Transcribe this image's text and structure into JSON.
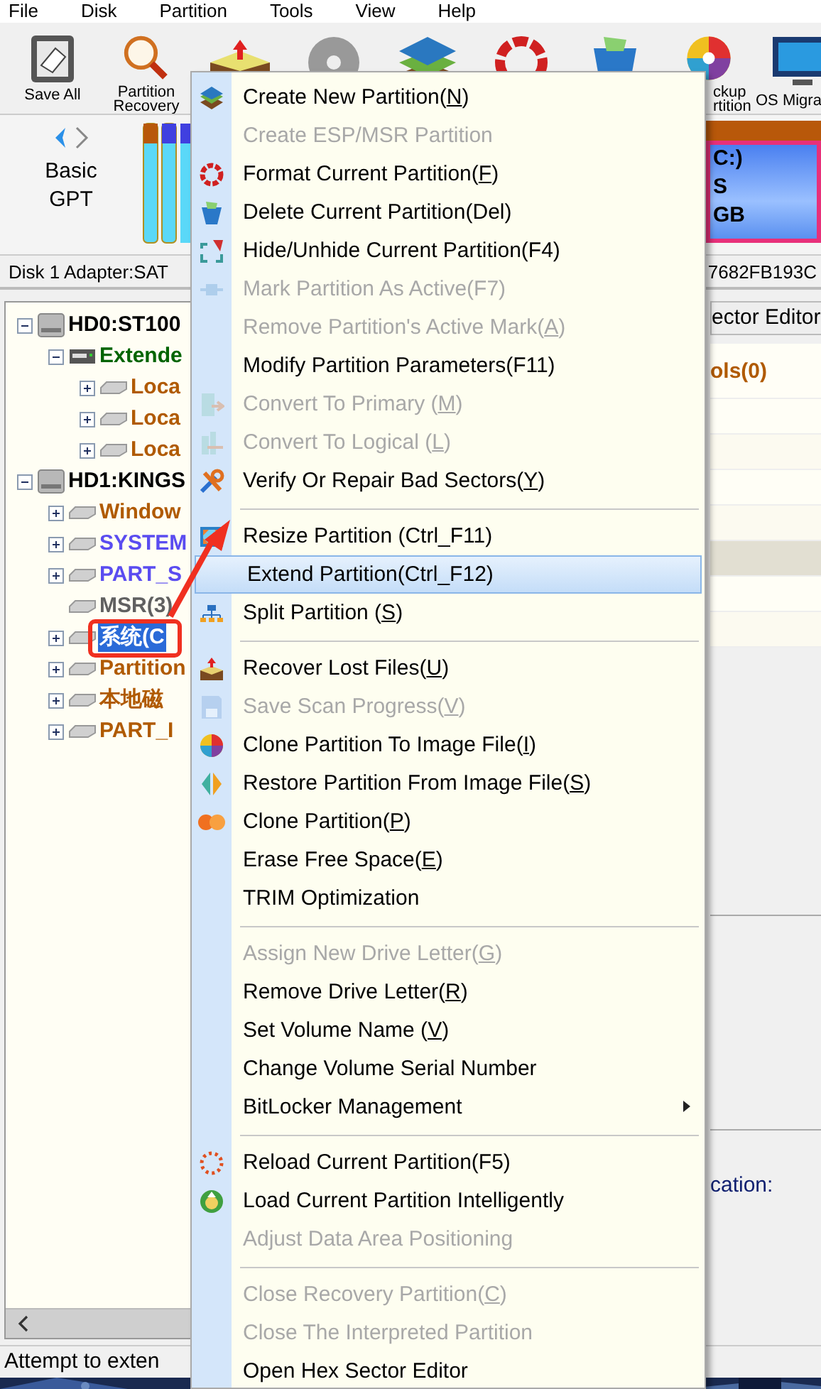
{
  "menubar": [
    "File",
    "Disk",
    "Partition",
    "Tools",
    "View",
    "Help"
  ],
  "toolbar": [
    {
      "lines": [
        "Save All"
      ]
    },
    {
      "lines": [
        "Partition",
        "Recovery"
      ]
    },
    {
      "lines": [
        "ckup",
        "rtition"
      ]
    },
    {
      "lines": [
        "OS Migra"
      ]
    }
  ],
  "disk_panel": {
    "style": [
      "Basic",
      "GPT"
    ],
    "partition": [
      "C:)",
      "S",
      "GB"
    ]
  },
  "disk_info": {
    "adapter": "Disk 1 Adapter:SAT",
    "serial": "7682FB193C"
  },
  "tree": {
    "nodes": [
      {
        "label": "HD0:ST100",
        "kind": "disk",
        "color": "#000000",
        "expanded": true,
        "selected": false,
        "children": [
          {
            "label": "Extende",
            "kind": "extended",
            "color": "#006400",
            "expanded": true,
            "selected": false,
            "children": [
              {
                "label": "Loca",
                "kind": "partition",
                "color": "#b05a00",
                "expanded": false,
                "selected": false
              },
              {
                "label": "Loca",
                "kind": "partition",
                "color": "#b05a00",
                "expanded": false,
                "selected": false
              },
              {
                "label": "Loca",
                "kind": "partition",
                "color": "#b05a00",
                "expanded": false,
                "selected": false
              }
            ]
          }
        ]
      },
      {
        "label": "HD1:KINGS",
        "kind": "disk",
        "color": "#000000",
        "expanded": true,
        "selected": false,
        "children": [
          {
            "label": "Window",
            "kind": "partition",
            "color": "#b05a00",
            "expanded": false,
            "selected": false
          },
          {
            "label": "SYSTEM",
            "kind": "partition",
            "color": "#5a4cf0",
            "expanded": false,
            "selected": false
          },
          {
            "label": "PART_S",
            "kind": "partition",
            "color": "#5a4cf0",
            "expanded": false,
            "selected": false
          },
          {
            "label": "MSR(3)",
            "kind": "partition",
            "color": "#606060",
            "selected": false
          },
          {
            "label": "系统(C",
            "kind": "partition",
            "expanded": false,
            "selected": true
          },
          {
            "label": "Partition",
            "kind": "partition",
            "color": "#b05a00",
            "expanded": false,
            "selected": false
          },
          {
            "label": "本地磁",
            "kind": "partition",
            "color": "#b05a00",
            "expanded": false,
            "selected": false
          },
          {
            "label": "PART_I",
            "kind": "partition",
            "color": "#b05a00",
            "expanded": false,
            "selected": false
          }
        ]
      }
    ]
  },
  "side_panel": {
    "tab": "ector Editor",
    "heading": "ols(0)",
    "field_label": "cation:"
  },
  "context_menu": [
    {
      "kind": "item",
      "pre": "Create New Partition(",
      "key": "N",
      "post": ")",
      "disabled": false,
      "selected": false
    },
    {
      "kind": "item",
      "pre": "Create ESP/MSR Partition",
      "disabled": true,
      "selected": false
    },
    {
      "kind": "item",
      "pre": "Format Current Partition(",
      "key": "F",
      "post": ")",
      "disabled": false,
      "selected": false
    },
    {
      "kind": "item",
      "pre": "Delete Current Partition(Del)",
      "disabled": false,
      "selected": false
    },
    {
      "kind": "item",
      "pre": "Hide/Unhide Current Partition(F4)",
      "disabled": false,
      "selected": false
    },
    {
      "kind": "item",
      "pre": "Mark Partition As Active(F7)",
      "disabled": true,
      "selected": false
    },
    {
      "kind": "item",
      "pre": "Remove Partition's Active Mark(",
      "key": "A",
      "post": ")",
      "disabled": true,
      "selected": false
    },
    {
      "kind": "item",
      "pre": "Modify Partition Parameters(F11)",
      "disabled": false,
      "selected": false
    },
    {
      "kind": "item",
      "pre": "Convert To Primary (",
      "key": "M",
      "post": ")",
      "disabled": true,
      "selected": false
    },
    {
      "kind": "item",
      "pre": "Convert To Logical (",
      "key": "L",
      "post": ")",
      "disabled": true,
      "selected": false
    },
    {
      "kind": "item",
      "pre": "Verify Or Repair Bad Sectors(",
      "key": "Y",
      "post": ")",
      "disabled": false,
      "selected": false
    },
    {
      "kind": "separator"
    },
    {
      "kind": "item",
      "pre": "Resize Partition (Ctrl_F11)",
      "disabled": false,
      "selected": false
    },
    {
      "kind": "item",
      "pre": "Extend Partition(Ctrl_F12)",
      "disabled": false,
      "selected": true
    },
    {
      "kind": "item",
      "pre": "Split Partition (",
      "key": "S",
      "post": ")",
      "disabled": false,
      "selected": false
    },
    {
      "kind": "separator"
    },
    {
      "kind": "item",
      "pre": "Recover Lost Files(",
      "key": "U",
      "post": ")",
      "disabled": false,
      "selected": false
    },
    {
      "kind": "item",
      "pre": "Save Scan Progress(",
      "key": "V",
      "post": ")",
      "disabled": true,
      "selected": false
    },
    {
      "kind": "item",
      "pre": "Clone Partition To Image File(",
      "key": "I",
      "post": ")",
      "disabled": false,
      "selected": false
    },
    {
      "kind": "item",
      "pre": "Restore Partition From Image File(",
      "key": "S",
      "post": ")",
      "disabled": false,
      "selected": false
    },
    {
      "kind": "item",
      "pre": "Clone Partition(",
      "key": "P",
      "post": ")",
      "disabled": false,
      "selected": false
    },
    {
      "kind": "item",
      "pre": "Erase Free Space(",
      "key": "E",
      "post": ")",
      "disabled": false,
      "selected": false
    },
    {
      "kind": "item",
      "pre": "TRIM Optimization",
      "disabled": false,
      "selected": false
    },
    {
      "kind": "separator"
    },
    {
      "kind": "item",
      "pre": "Assign New Drive Letter(",
      "key": "G",
      "post": ")",
      "disabled": true,
      "selected": false
    },
    {
      "kind": "item",
      "pre": "Remove Drive Letter(",
      "key": "R",
      "post": ")",
      "disabled": false,
      "selected": false
    },
    {
      "kind": "item",
      "pre": "Set Volume Name (",
      "key": "V",
      "post": ")",
      "disabled": false,
      "selected": false
    },
    {
      "kind": "item",
      "pre": "Change Volume Serial Number",
      "disabled": false,
      "selected": false
    },
    {
      "kind": "item",
      "pre": "BitLocker Management",
      "disabled": false,
      "selected": false,
      "submenu": true
    },
    {
      "kind": "separator"
    },
    {
      "kind": "item",
      "pre": "Reload Current Partition(F5)",
      "disabled": false,
      "selected": false
    },
    {
      "kind": "item",
      "pre": "Load Current Partition Intelligently",
      "disabled": false,
      "selected": false
    },
    {
      "kind": "item",
      "pre": "Adjust Data Area Positioning",
      "disabled": true,
      "selected": false
    },
    {
      "kind": "separator"
    },
    {
      "kind": "item",
      "pre": "Close Recovery Partition(",
      "key": "C",
      "post": ")",
      "disabled": true,
      "selected": false
    },
    {
      "kind": "item",
      "pre": "Close The Interpreted Partition",
      "disabled": true,
      "selected": false
    },
    {
      "kind": "item",
      "pre": "Open Hex Sector Editor",
      "disabled": false,
      "selected": false
    }
  ],
  "status_bar": "Attempt to exten"
}
